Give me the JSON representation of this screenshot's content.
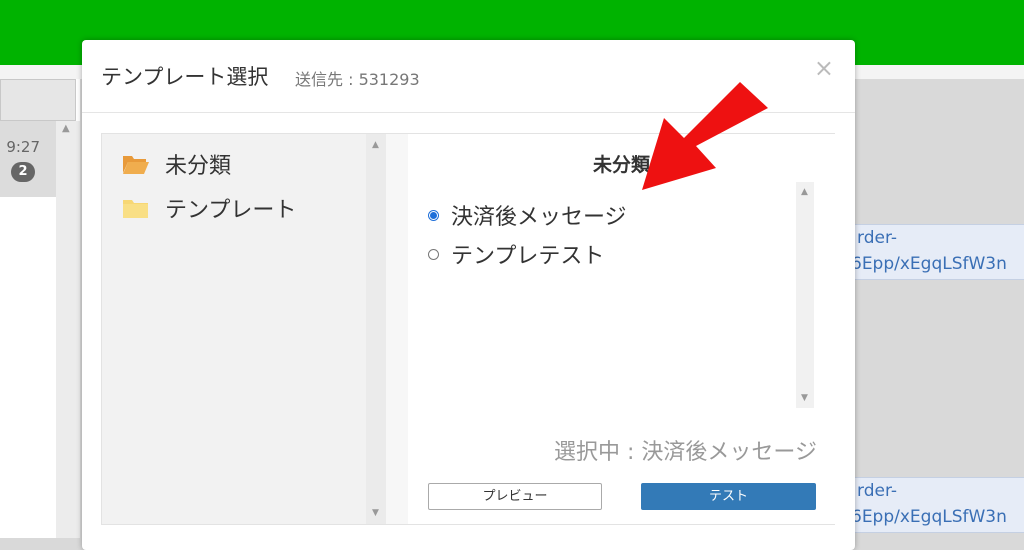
{
  "background": {
    "time": "9:27",
    "badge": "2",
    "link1_line1": "rder-",
    "link1_line2": "6Epp/xEgqLSfW3n",
    "link2_line1": "rder-",
    "link2_line2": "6Epp/xEgqLSfW3n"
  },
  "modal": {
    "title": "テンプレート選択",
    "subtitle": "送信先 : 531293",
    "close": "×"
  },
  "tree": {
    "folders": [
      {
        "label": "未分類",
        "icon": "folder-open-icon",
        "color": "#f0ad4e"
      },
      {
        "label": "テンプレート",
        "icon": "folder-icon",
        "color": "#f7d774"
      }
    ]
  },
  "list": {
    "title": "未分類",
    "items": [
      {
        "label": "決済後メッセージ",
        "checked": true
      },
      {
        "label": "テンプレテスト",
        "checked": false
      }
    ]
  },
  "selected": "選択中 : 決済後メッセージ",
  "buttons": {
    "preview": "プレビュー",
    "test": "テスト"
  },
  "colors": {
    "topbar": "#00b300",
    "primary": "#337ab7",
    "arrow": "#ee1111"
  }
}
